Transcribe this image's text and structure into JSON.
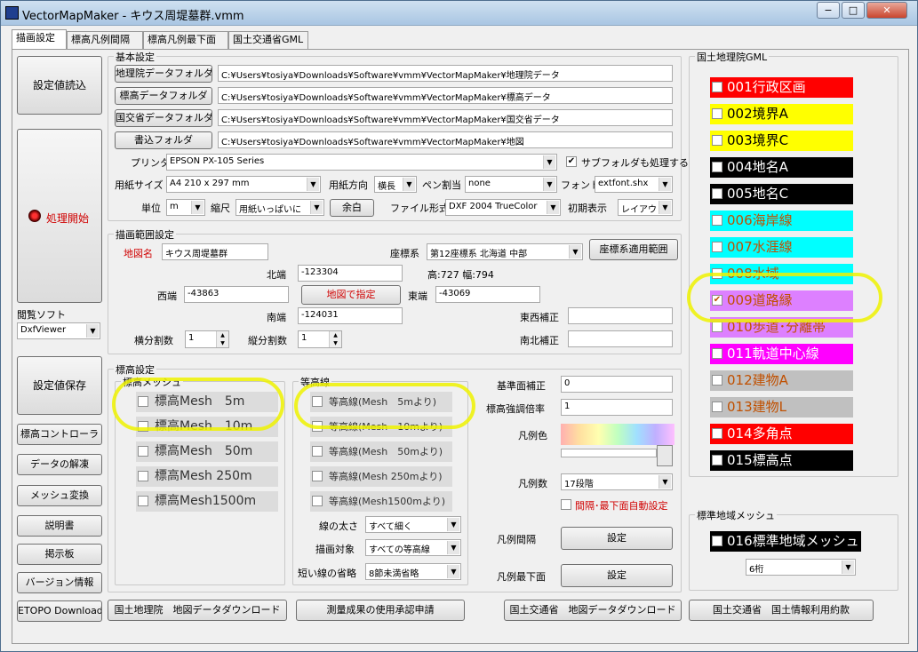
{
  "window": {
    "title": "VectorMapMaker - キウス周堤墓群.vmm",
    "min": "−",
    "max": "□",
    "close": "✕"
  },
  "tabs": [
    "描画設定",
    "標高凡例間隔",
    "標高凡例最下面",
    "国土交通省GML"
  ],
  "left": {
    "load": "設定値読込",
    "start": "処理開始",
    "viewer_label": "閲覧ソフト",
    "viewer": "DxfViewer",
    "save": "設定値保存",
    "contour": "標高コントローラ",
    "decode": "データの解凍",
    "mesh": "メッシュ変換",
    "manual": "説明書",
    "board": "掲示板",
    "version": "バージョン情報",
    "etopo": "ETOPO Download"
  },
  "basic": {
    "group": "基本設定",
    "folders": [
      {
        "btn": "地理院データフォルダ",
        "path": "C:¥Users¥tosiya¥Downloads¥Software¥vmm¥VectorMapMaker¥地理院データ"
      },
      {
        "btn": "標高データフォルダ",
        "path": "C:¥Users¥tosiya¥Downloads¥Software¥vmm¥VectorMapMaker¥標高データ"
      },
      {
        "btn": "国交省データフォルダ",
        "path": "C:¥Users¥tosiya¥Downloads¥Software¥vmm¥VectorMapMaker¥国交省データ"
      },
      {
        "btn": "書込フォルダ",
        "path": "C:¥Users¥tosiya¥Downloads¥Software¥vmm¥VectorMapMaker¥地図"
      }
    ],
    "printer_label": "プリンタ",
    "printer": "EPSON PX-105 Series",
    "subfolder": "サブフォルダも処理する",
    "paper_label": "用紙サイズ",
    "paper": "A4 210 x 297 mm",
    "dir_label": "用紙方向",
    "dir": "横長",
    "pen_label": "ペン割当",
    "pen": "none",
    "font_label": "フォント",
    "font": "extfont.shx",
    "unit_label": "単位",
    "unit": "m",
    "scale_label": "縮尺",
    "scale": "用紙いっぱいに",
    "margin": "余白",
    "fmt_label": "ファイル形式",
    "fmt": "DXF 2004 TrueColor",
    "init_label": "初期表示",
    "init": "レイアウト"
  },
  "range": {
    "group": "描画範囲設定",
    "name_label": "地図名",
    "name": "キウス周堤墓群",
    "crs_label": "座標系",
    "crs": "第12座標系 北海道 中部",
    "crs_btn": "座標系適用範囲",
    "north_label": "北端",
    "north": "-123304",
    "size": "高:727 幅:794",
    "west_label": "西端",
    "west": "-43863",
    "map_btn": "地図で指定",
    "east_label": "東端",
    "east": "-43069",
    "south_label": "南端",
    "south": "-124031",
    "ew_label": "東西補正",
    "ns_label": "南北補正",
    "hdiv_label": "横分割数",
    "hdiv": "1",
    "vdiv_label": "縦分割数",
    "vdiv": "1"
  },
  "elev": {
    "group": "標高設定",
    "mesh_group": "標高メッシュ",
    "mesh": [
      "標高Mesh　5m",
      "標高Mesh　10m",
      "標高Mesh　50m",
      "標高Mesh 250m",
      "標高Mesh1500m"
    ],
    "cont_group": "等高線",
    "cont": [
      "等高線(Mesh　5mより)",
      "等高線(Mesh　10mより)",
      "等高線(Mesh　50mより)",
      "等高線(Mesh 250mより)",
      "等高線(Mesh1500mより)"
    ],
    "width_label": "線の太さ",
    "width": "すべて細く",
    "target_label": "描画対象",
    "target": "すべての等高線",
    "short_label": "短い線の省略",
    "short": "8節未満省略",
    "base_label": "基準面補正",
    "base": "0",
    "mag_label": "標高強調倍率",
    "mag": "1",
    "color_label": "凡例色",
    "num_label": "凡例数",
    "num": "17段階",
    "auto": "間隔･最下面自動設定",
    "interval_label": "凡例間隔",
    "interval_btn": "設定",
    "bottom_label": "凡例最下面",
    "bottom_btn": "設定"
  },
  "gml": {
    "group": "国土地理院GML",
    "items": [
      {
        "label": "001行政区画",
        "bg": "#ff0000",
        "fg": "#ffffff",
        "checked": false
      },
      {
        "label": "002境界A",
        "bg": "#ffff00",
        "fg": "#000000",
        "checked": false
      },
      {
        "label": "003境界C",
        "bg": "#ffff00",
        "fg": "#000000",
        "checked": false
      },
      {
        "label": "004地名A",
        "bg": "#000000",
        "fg": "#ffffff",
        "checked": false
      },
      {
        "label": "005地名C",
        "bg": "#000000",
        "fg": "#ffffff",
        "checked": false
      },
      {
        "label": "006海岸線",
        "bg": "#00ffff",
        "fg": "#ffffff",
        "checked": false
      },
      {
        "label": "007水涯線",
        "bg": "#00ffff",
        "fg": "#ffffff",
        "checked": false
      },
      {
        "label": "008水域",
        "bg": "#00ffff",
        "fg": "#000000",
        "checked": false
      },
      {
        "label": "009道路縁",
        "bg": "#dd80ff",
        "fg": "#ffffff",
        "checked": true
      },
      {
        "label": "010歩道･分離帯",
        "bg": "#dd80ff",
        "fg": "#ffffff",
        "checked": false
      },
      {
        "label": "011軌道中心線",
        "bg": "#ff00ff",
        "fg": "#ffffff",
        "checked": false
      },
      {
        "label": "012建物A",
        "bg": "#c0c0c0",
        "fg": "#ffffff",
        "checked": false
      },
      {
        "label": "013建物L",
        "bg": "#c0c0c0",
        "fg": "#ffffff",
        "checked": false
      },
      {
        "label": "014多角点",
        "bg": "#ff0000",
        "fg": "#ffffff",
        "checked": false
      },
      {
        "label": "015標高点",
        "bg": "#000000",
        "fg": "#ffffff",
        "checked": false
      }
    ]
  },
  "std": {
    "group": "標準地域メッシュ",
    "item": "016標準地域メッシュ",
    "digits": "6桁"
  },
  "bottom": {
    "gsi": "国土地理院　地図データダウンロード",
    "survey": "測量成果の使用承認申請",
    "mlit": "国土交通省　地図データダウンロード",
    "terms": "国土交通省　国土情報利用約款"
  }
}
